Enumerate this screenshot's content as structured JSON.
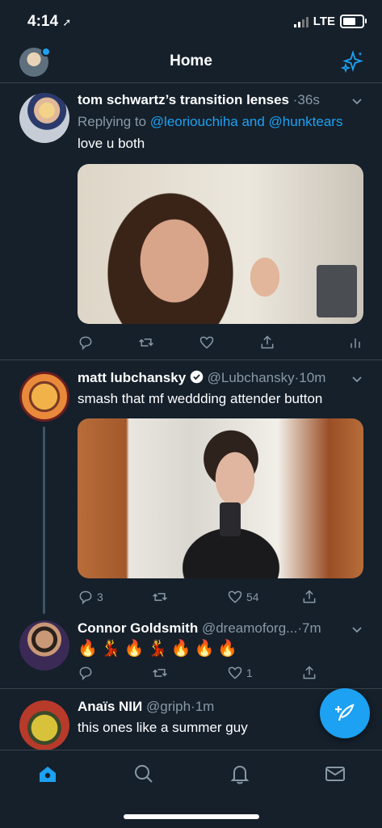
{
  "status_bar": {
    "time": "4:14",
    "network": "LTE",
    "battery_level": 0.85
  },
  "header": {
    "title": "Home"
  },
  "tweets": [
    {
      "name": "tom schwartz’s transition lenses",
      "handle": "",
      "time": "36s",
      "reply_prefix": "Replying to",
      "reply_users": "@leoriouchiha and @hunktears",
      "text": "love u both",
      "replies": "",
      "retweets": "",
      "likes": ""
    },
    {
      "name": "matt lubchansky",
      "verified": true,
      "handle": "@Lubchansky",
      "time": "10m",
      "text": "smash that mf weddding attender button",
      "replies": "3",
      "retweets": "",
      "likes": "54"
    },
    {
      "name": "Connor Goldsmith",
      "handle": "@dreamoforg...",
      "time": "7m",
      "text": "🔥💃🔥💃🔥🔥🔥",
      "replies": "",
      "retweets": "",
      "likes": "1"
    },
    {
      "name": "Anaïs NIИ",
      "handle": "@griph",
      "time": "1m",
      "text": "this ones like a summer guy"
    }
  ],
  "separator": "·",
  "colors": {
    "background": "#15202b",
    "accent": "#1da1f2",
    "muted": "#8899a6",
    "divider": "#38444d"
  },
  "icons": {
    "header": [
      "profile-avatar",
      "sparkle-icon"
    ],
    "actions": [
      "reply-icon",
      "retweet-icon",
      "like-icon",
      "share-icon",
      "analytics-icon"
    ],
    "tabs": [
      "home-icon",
      "search-icon",
      "notifications-icon",
      "messages-icon"
    ],
    "fab": "compose-icon"
  }
}
